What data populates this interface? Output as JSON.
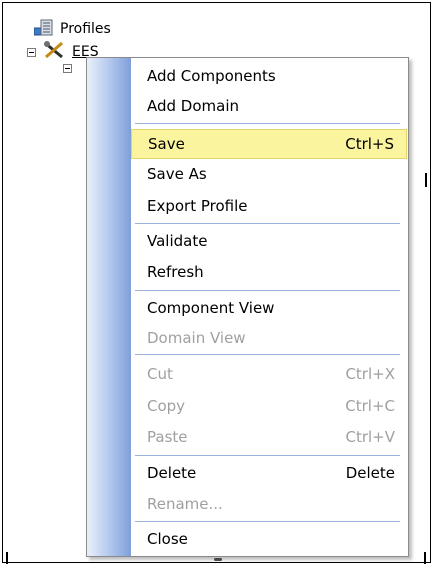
{
  "tree": {
    "root_label": "Profiles",
    "child_label": "EES"
  },
  "context_menu": {
    "items": [
      {
        "label": "Add Components",
        "shortcut": "",
        "disabled": false
      },
      {
        "label": "Add Domain",
        "shortcut": "",
        "disabled": false
      },
      {
        "label": "Save",
        "shortcut": "Ctrl+S",
        "disabled": false
      },
      {
        "label": "Save As",
        "shortcut": "",
        "disabled": false
      },
      {
        "label": "Export Profile",
        "shortcut": "",
        "disabled": false
      },
      {
        "label": "Validate",
        "shortcut": "",
        "disabled": false
      },
      {
        "label": "Refresh",
        "shortcut": "",
        "disabled": false
      },
      {
        "label": "Component View",
        "shortcut": "",
        "disabled": false
      },
      {
        "label": "Domain View",
        "shortcut": "",
        "disabled": true
      },
      {
        "label": "Cut",
        "shortcut": "Ctrl+X",
        "disabled": true
      },
      {
        "label": "Copy",
        "shortcut": "Ctrl+C",
        "disabled": true
      },
      {
        "label": "Paste",
        "shortcut": "Ctrl+V",
        "disabled": true
      },
      {
        "label": "Delete",
        "shortcut": "Delete",
        "disabled": false
      },
      {
        "label": "Rename...",
        "shortcut": "",
        "disabled": true
      },
      {
        "label": "Close",
        "shortcut": "",
        "disabled": false
      }
    ]
  },
  "colors": {
    "highlight": "#fbf49e",
    "separator": "#9db3de",
    "disabled_text": "#a0a0a0"
  }
}
